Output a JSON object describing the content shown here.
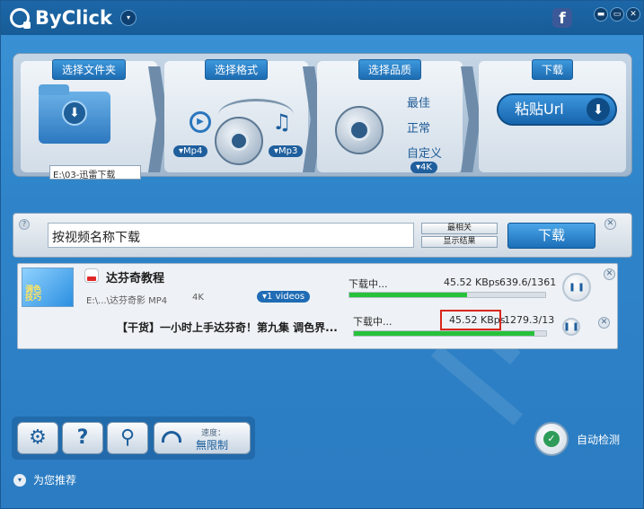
{
  "app": {
    "name": "ByClick"
  },
  "window_controls": {
    "menu": "▾",
    "facebook": "f",
    "minimize": "▬",
    "restore": "▭",
    "close": "✕"
  },
  "steps": {
    "folder": {
      "title": "选择文件夹",
      "path": "E:\\03-迅雷下载"
    },
    "format": {
      "title": "选择格式",
      "video_format": "Mp4",
      "audio_format": "Mp3"
    },
    "quality": {
      "title": "选择品质",
      "options": [
        "最佳",
        "正常",
        "自定义"
      ],
      "selected": "4K"
    },
    "download": {
      "title": "下载",
      "paste_label": "粘贴Url",
      "arrow": "⬇"
    }
  },
  "search": {
    "value": "按视频名称下载",
    "sort_relevance": "最相关",
    "show_results": "显示结果",
    "download_label": "下载",
    "help": "?",
    "close": "✕"
  },
  "download_item": {
    "thumbnail_text": "调色\n技巧",
    "channel": "达芬奇教程",
    "path": "E:\\...\\达芬奇影 MP4",
    "quality": "4K",
    "videos_badge": "1 videos",
    "status": "下载中...",
    "speed": "45.52 KBps",
    "progress_text": "639.6/1361",
    "progress": 0.6,
    "close": "✕",
    "sub": {
      "title": "【干货】一小时上手达芬奇！第九集 调色界...",
      "status": "下载中...",
      "speed": "45.52 KBps",
      "progress_text": "1279.3/13",
      "progress": 0.94,
      "close": "✕"
    }
  },
  "toolbar": {
    "settings": "⚙",
    "help": "?",
    "search": "⚲",
    "speed_label": "速度：",
    "speed_value": "無限制"
  },
  "auto_detect": {
    "label": "自动检测"
  },
  "recommend": {
    "label": "为您推荐",
    "arrow": "▾"
  },
  "colors": {
    "accent": "#2f84c9",
    "progress": "#27c23a",
    "highlight": "#d8261d"
  }
}
